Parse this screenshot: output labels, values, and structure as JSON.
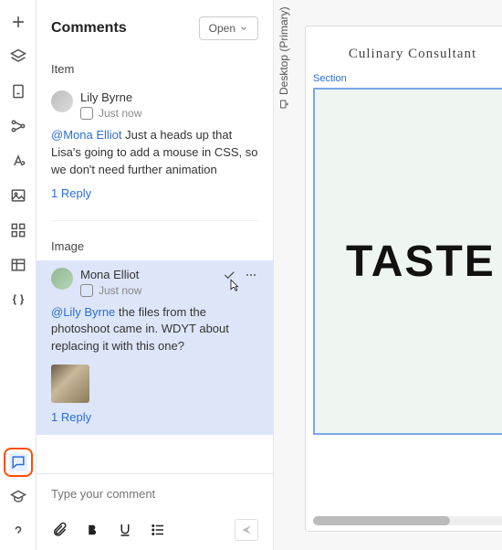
{
  "header": {
    "title": "Comments",
    "filter_label": "Open"
  },
  "sections": {
    "item_label": "Item",
    "image_label": "Image"
  },
  "comment1": {
    "author": "Lily Byrne",
    "time": "Just now",
    "mention": "@Mona Elliot",
    "body_after": " Just a heads up that Lisa's going to add a mouse in CSS, so we don't need further animation",
    "reply": "1 Reply"
  },
  "comment2": {
    "author": "Mona Elliot",
    "time": "Just now",
    "mention": "@Lily Byrne",
    "body_after": "  the files from the photoshoot came in. WDYT about replacing it with this one?",
    "reply": "1 Reply"
  },
  "input": {
    "placeholder": "Type your comment"
  },
  "canvas": {
    "orientation_label": "Desktop (Primary)",
    "page_title": "Culinary Consultant",
    "section_label": "Section",
    "hero_text": "TASTE"
  }
}
